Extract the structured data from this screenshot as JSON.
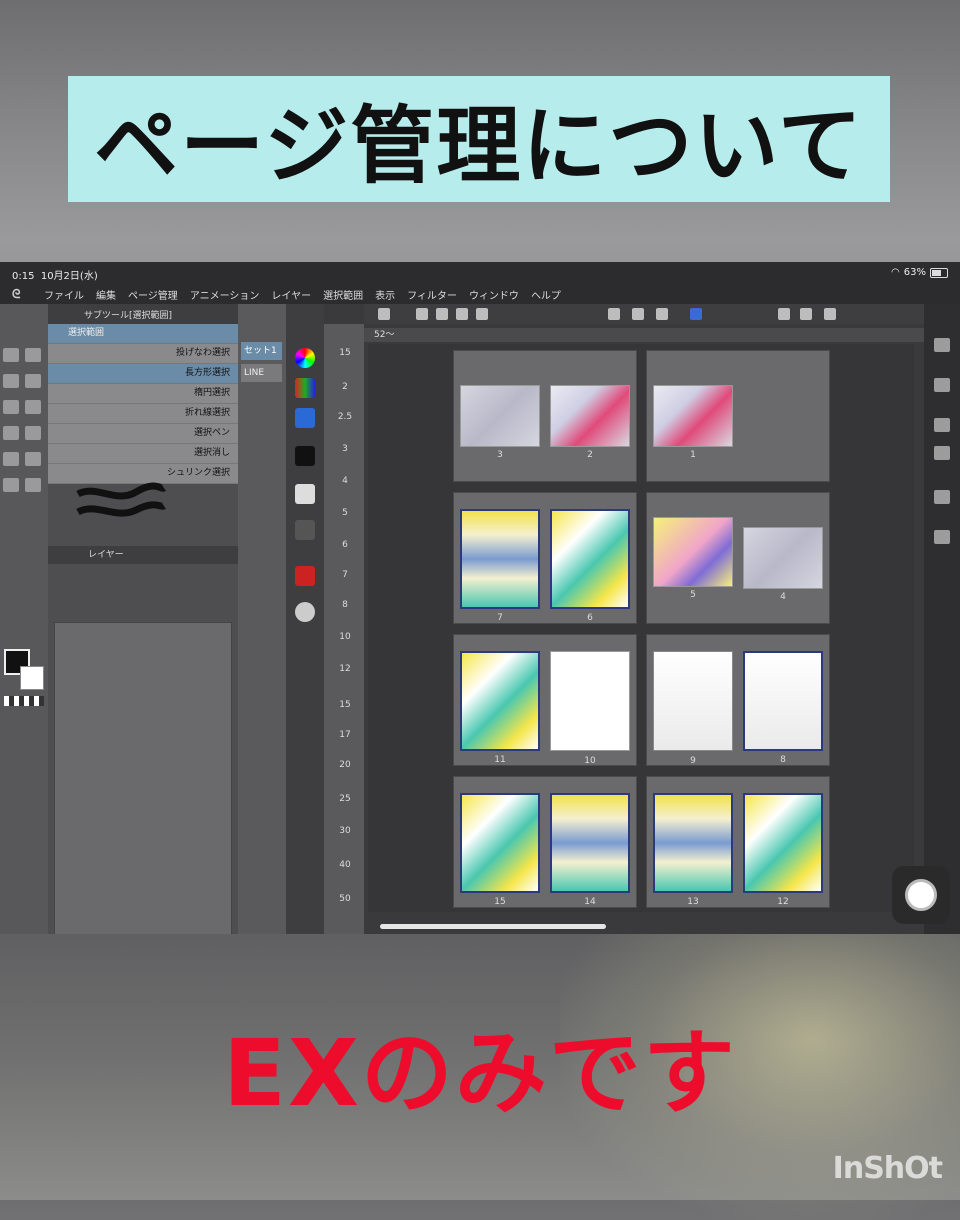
{
  "title_banner": "ページ管理について",
  "bottom_caption": "EXのみです",
  "watermark": "InShOt",
  "statusbar": {
    "time": "0:15",
    "date": "10月2日(水)",
    "battery": "63%"
  },
  "menu": [
    "ファイル",
    "編集",
    "ページ管理",
    "アニメーション",
    "レイヤー",
    "選択範囲",
    "表示",
    "フィルター",
    "ウィンドウ",
    "ヘルプ"
  ],
  "subtool": {
    "header": "サブツール[選択範囲]",
    "items": [
      "選択範囲",
      "投げなわ選択",
      "長方形選択",
      "楕円選択",
      "折れ線選択",
      "選択ペン",
      "選択消し",
      "シュリンク選択"
    ]
  },
  "layer_header": "レイヤー",
  "mid_panel": {
    "set_label": "セット1",
    "line_label": "LINE"
  },
  "tab_label": "52～",
  "ruler": [
    "15",
    "2",
    "2.5",
    "3",
    "4",
    "5",
    "6",
    "7",
    "8",
    "10",
    "12",
    "15",
    "17",
    "20",
    "25",
    "30",
    "40",
    "50"
  ],
  "spreads": [
    {
      "pages": [
        "3",
        "2"
      ]
    },
    {
      "pages": [
        "1"
      ]
    },
    {
      "pages": [
        "7",
        "6"
      ]
    },
    {
      "pages": [
        "5",
        "4"
      ]
    },
    {
      "pages": [
        "11",
        "10"
      ]
    },
    {
      "pages": [
        "9",
        "8"
      ]
    },
    {
      "pages": [
        "15",
        "14"
      ]
    },
    {
      "pages": [
        "13",
        "12"
      ]
    }
  ]
}
